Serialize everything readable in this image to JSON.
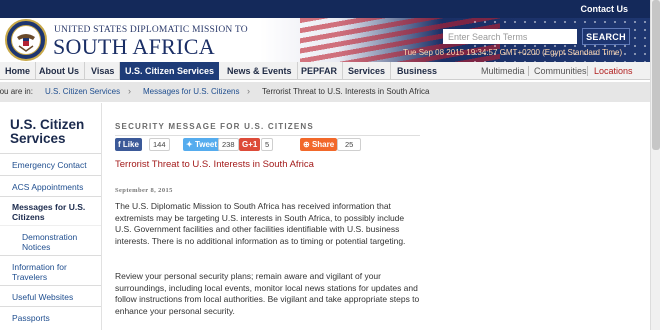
{
  "topbar": {
    "contact_label": "Contact Us"
  },
  "header": {
    "mission_line": "UNITED STATES DIPLOMATIC MISSION TO",
    "country": "SOUTH AFRICA",
    "search_placeholder": "Enter Search Terms",
    "search_button": "SEARCH",
    "datetime": "Tue Sep 08 2015 19:34:57 GMT+0200 (Egypt Standard Time)"
  },
  "nav": {
    "items": [
      "Home",
      "About Us",
      "Visas",
      "U.S. Citizen Services",
      "News & Events",
      "PEPFAR",
      "Services",
      "Business"
    ],
    "active": "U.S. Citizen Services",
    "right_items": [
      "Multimedia",
      "Communities",
      "Locations"
    ]
  },
  "breadcrumb": {
    "prefix": "You are in:",
    "items": [
      "U.S. Citizen Services",
      "Messages for U.S. Citizens",
      "Terrorist Threat to U.S. Interests in South Africa"
    ]
  },
  "sidebar": {
    "title": "U.S. Citizen Services",
    "items": [
      {
        "label": "Emergency Contact"
      },
      {
        "label": "ACS Appointments"
      },
      {
        "label": "Messages for U.S. Citizens"
      },
      {
        "label": "Demonstration Notices"
      },
      {
        "label": "Information for Travelers"
      },
      {
        "label": "Useful Websites"
      },
      {
        "label": "Passports"
      }
    ]
  },
  "article": {
    "section_title": "SECURITY MESSAGE FOR U.S. CITIZENS",
    "social": {
      "like_label": "Like",
      "like_count": "144",
      "tweet_label": "Tweet",
      "tweet_count": "238",
      "gplus_label": "G+1",
      "gplus_count": "5",
      "share_label": "Share",
      "share_count": "25"
    },
    "headline": "Terrorist Threat to U.S. Interests in South Africa",
    "date": "September 8, 2015",
    "paragraph1": "The U.S. Diplomatic Mission to South Africa has received information that extremists may be targeting U.S. interests in South Africa, to possibly include U.S. Government facilities and other facilities identifiable with U.S. business interests.  There is no additional information as to timing or potential targeting.",
    "paragraph2": "Review your personal security plans; remain aware and vigilant of your surroundings, including local events, monitor local news stations for updates and follow instructions from local authorities. Be vigilant and take appropriate steps to enhance your personal security."
  },
  "colors": {
    "navy": "#14295a",
    "active_tab": "#1e3c78",
    "headline_red": "#a31b1b",
    "facebook": "#3b5998",
    "twitter": "#55acee",
    "gplus": "#dd4b39",
    "share": "#f2682a"
  }
}
